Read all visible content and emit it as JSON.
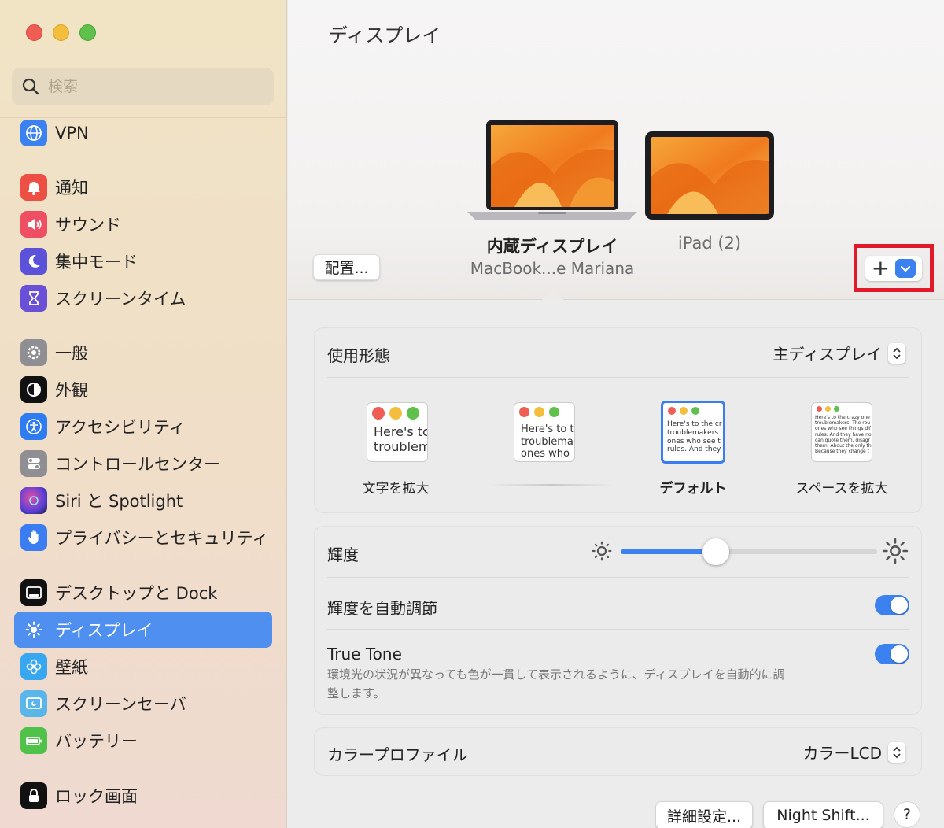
{
  "window": {
    "title": "ディスプレイ"
  },
  "search": {
    "placeholder": "検索"
  },
  "sidebar": {
    "items": [
      {
        "label": "VPN",
        "icon": "globe-icon",
        "color": "#3b82f0"
      },
      {
        "label": "通知",
        "icon": "bell-icon",
        "color": "#ee4f45"
      },
      {
        "label": "サウンド",
        "icon": "speaker-icon",
        "color": "#ee4f62"
      },
      {
        "label": "集中モード",
        "icon": "moon-icon",
        "color": "#5b52d9"
      },
      {
        "label": "スクリーンタイム",
        "icon": "hourglass-icon",
        "color": "#6a50d6"
      },
      {
        "label": "一般",
        "icon": "gear-icon",
        "color": "#8e8e93"
      },
      {
        "label": "外観",
        "icon": "appearance-icon",
        "color": "#111111"
      },
      {
        "label": "アクセシビリティ",
        "icon": "accessibility-icon",
        "color": "#2e7cf0"
      },
      {
        "label": "コントロールセンター",
        "icon": "control-center-icon",
        "color": "#8e8e93"
      },
      {
        "label": "Siri と Spotlight",
        "icon": "siri-icon",
        "color": "#7a3fd0"
      },
      {
        "label": "プライバシーとセキュリティ",
        "icon": "hand-icon",
        "color": "#3b7df0"
      },
      {
        "label": "デスクトップと Dock",
        "icon": "dock-icon",
        "color": "#111111"
      },
      {
        "label": "ディスプレイ",
        "icon": "sun-icon",
        "color": "#3b82f0"
      },
      {
        "label": "壁紙",
        "icon": "flower-icon",
        "color": "#37a8f0"
      },
      {
        "label": "スクリーンセーバ",
        "icon": "screensaver-icon",
        "color": "#5ab6e8"
      },
      {
        "label": "バッテリー",
        "icon": "battery-icon",
        "color": "#50c24a"
      },
      {
        "label": "ロック画面",
        "icon": "lock-icon",
        "color": "#111111"
      }
    ]
  },
  "displays": {
    "arrange_label": "配置...",
    "primary": {
      "name": "内蔵ディスプレイ",
      "model": "MacBook...e Mariana"
    },
    "secondary": {
      "name": "iPad (2)"
    },
    "add_label": "+"
  },
  "usage": {
    "label": "使用形態",
    "value": "主ディスプレイ",
    "modes": [
      {
        "label": "文字を拡大",
        "preview": [
          "Here's tc",
          "troublem"
        ]
      },
      {
        "label": "",
        "preview": [
          "Here's to t",
          "troublema",
          "ones who"
        ]
      },
      {
        "label": "デフォルト",
        "preview": [
          "Here's to the cr",
          "troublemakers.",
          "ones who see t",
          "rules. And they"
        ]
      },
      {
        "label": "スペースを拡大",
        "preview": [
          "Here's to the crazy one",
          "troublemakers. The rou",
          "ones who see things dif",
          "rules. And they have no",
          "can quote them, disagr",
          "them. About the only th",
          "Because they change t"
        ]
      }
    ]
  },
  "brightness": {
    "label": "輝度",
    "level": 0.37,
    "auto_label": "輝度を自動調節",
    "auto_on": true,
    "true_tone_label": "True Tone",
    "true_tone_desc_1": "環境光の状況が異なっても色が一貫して表示されるように、ディスプレイを自動的に調",
    "true_tone_desc_2": "整します。",
    "true_tone_on": true
  },
  "color_profile": {
    "label": "カラープロファイル",
    "value": "カラーLCD"
  },
  "footer": {
    "advanced_label": "詳細設定...",
    "night_shift_label": "Night Shift...",
    "help_label": "?"
  },
  "colors": {
    "accent": "#3b82f0",
    "highlight_box": "#e01a2a"
  }
}
